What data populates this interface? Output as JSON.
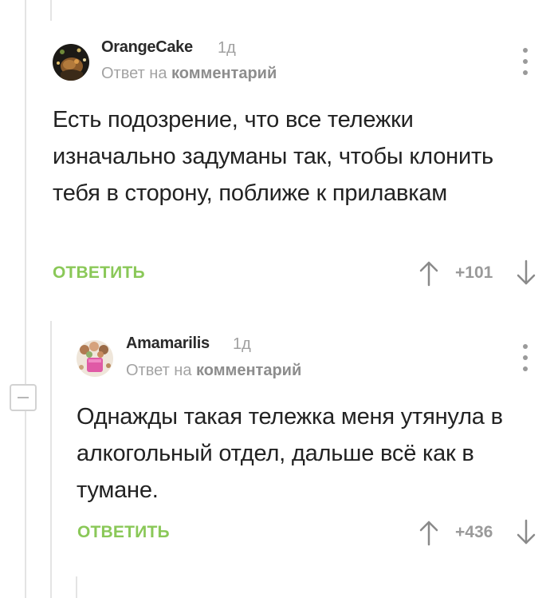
{
  "comments": [
    {
      "author": "OrangeCake",
      "time": "1д",
      "reply_prefix": "Ответ на",
      "reply_target": "комментарий",
      "text": "Есть подозрение, что все тележки изначально задуманы так, чтобы клонить тебя в сторону, поближе к прилавкам",
      "reply_label": "ОТВЕТИТЬ",
      "rating": "+101"
    },
    {
      "author": "Amamarilis",
      "time": "1д",
      "reply_prefix": "Ответ на",
      "reply_target": "комментарий",
      "text": "Однажды такая тележка меня утянула в алкогольный отдел, дальше всё как в тумане.",
      "reply_label": "ОТВЕТИТЬ",
      "rating": "+436"
    }
  ],
  "colors": {
    "reply_green": "#8ac858",
    "meta_gray": "#a3a3a3",
    "thread_line": "#e4e4e4"
  },
  "icons": {
    "menu": "vertical-ellipsis",
    "upvote": "arrow-up",
    "downvote": "arrow-down",
    "collapse": "minus-square"
  }
}
